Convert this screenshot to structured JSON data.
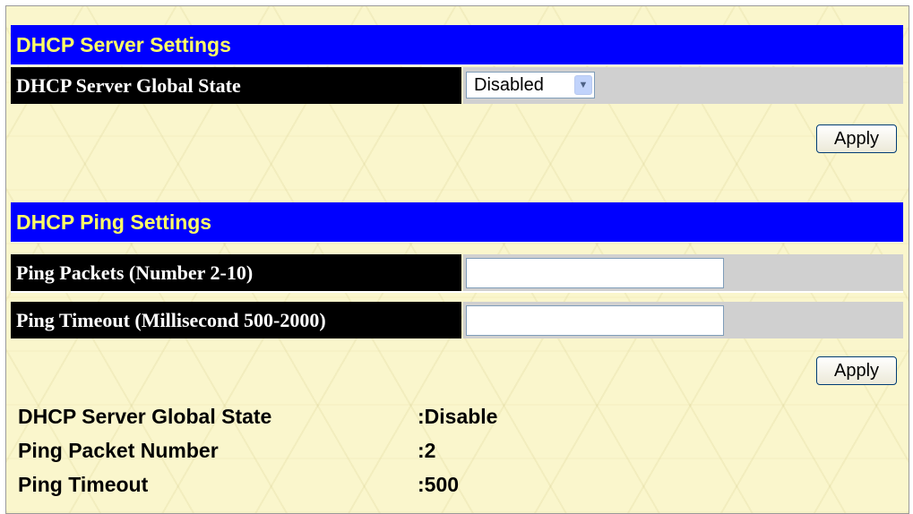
{
  "server_section": {
    "title": "DHCP Server Settings",
    "global_state_label": "DHCP Server Global State",
    "global_state_value": "Disabled",
    "apply_label": "Apply"
  },
  "ping_section": {
    "title": "DHCP Ping Settings",
    "packets_label": "Ping Packets (Number 2-10)",
    "packets_value": "",
    "timeout_label": "Ping Timeout (Millisecond 500-2000)",
    "timeout_value": "",
    "apply_label": "Apply"
  },
  "status": [
    {
      "key": "DHCP Server Global State",
      "value": ":Disable"
    },
    {
      "key": "Ping Packet Number",
      "value": ":2"
    },
    {
      "key": "Ping Timeout",
      "value": ":500"
    }
  ],
  "colors": {
    "header_bg": "#0000ff",
    "header_text": "#ffff66",
    "label_bg": "#000000",
    "cell_bg": "#d0d0d0",
    "page_bg": "#faf6cc"
  },
  "icons": {
    "dropdown_arrow": "chevron-down-icon"
  }
}
